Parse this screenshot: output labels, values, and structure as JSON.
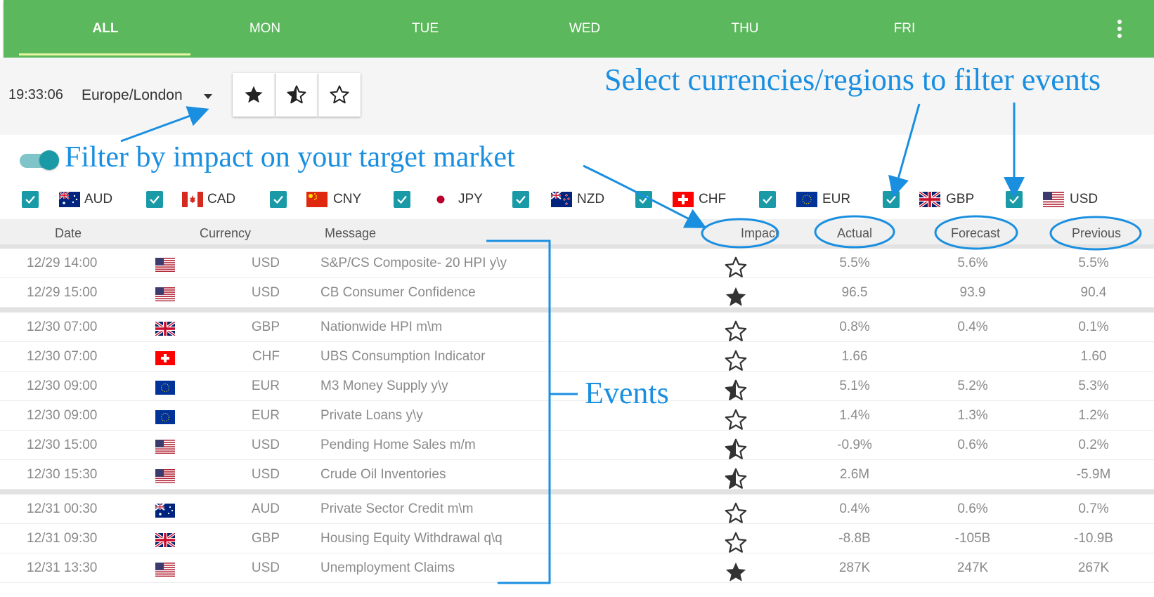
{
  "tabs": [
    {
      "label": "ALL",
      "active": true
    },
    {
      "label": "MON",
      "active": false
    },
    {
      "label": "TUE",
      "active": false
    },
    {
      "label": "WED",
      "active": false
    },
    {
      "label": "THU",
      "active": false
    },
    {
      "label": "FRI",
      "active": false
    }
  ],
  "toolbar": {
    "time": "19:33:06",
    "timezone": "Europe/London",
    "impact_filters": [
      "high-impact-star-icon",
      "medium-impact-star-icon",
      "low-impact-star-icon"
    ]
  },
  "filter": {
    "impact_toggle_on": true,
    "currencies": [
      {
        "code": "AUD",
        "checked": true
      },
      {
        "code": "CAD",
        "checked": true
      },
      {
        "code": "CNY",
        "checked": true
      },
      {
        "code": "JPY",
        "checked": true
      },
      {
        "code": "NZD",
        "checked": true
      },
      {
        "code": "CHF",
        "checked": true
      },
      {
        "code": "EUR",
        "checked": true
      },
      {
        "code": "GBP",
        "checked": true
      },
      {
        "code": "USD",
        "checked": true
      }
    ]
  },
  "table": {
    "headers": {
      "date": "Date",
      "currency": "Currency",
      "message": "Message",
      "impact": "Impact",
      "actual": "Actual",
      "forecast": "Forecast",
      "previous": "Previous"
    },
    "rows": [
      {
        "date": "12/29 14:00",
        "currency": "USD",
        "message": "S&P/CS Composite- 20 HPI y\\y",
        "impact": "low",
        "actual": "5.5%",
        "forecast": "5.6%",
        "previous": "5.5%",
        "day_start": true
      },
      {
        "date": "12/29 15:00",
        "currency": "USD",
        "message": "CB Consumer Confidence",
        "impact": "high",
        "actual": "96.5",
        "forecast": "93.9",
        "previous": "90.4",
        "day_start": false
      },
      {
        "date": "12/30 07:00",
        "currency": "GBP",
        "message": "Nationwide HPI m\\m",
        "impact": "low",
        "actual": "0.8%",
        "forecast": "0.4%",
        "previous": "0.1%",
        "day_start": true
      },
      {
        "date": "12/30 07:00",
        "currency": "CHF",
        "message": "UBS Consumption Indicator",
        "impact": "low",
        "actual": "1.66",
        "forecast": "",
        "previous": "1.60",
        "day_start": false
      },
      {
        "date": "12/30 09:00",
        "currency": "EUR",
        "message": "M3 Money Supply y\\y",
        "impact": "medium",
        "actual": "5.1%",
        "forecast": "5.2%",
        "previous": "5.3%",
        "day_start": false
      },
      {
        "date": "12/30 09:00",
        "currency": "EUR",
        "message": "Private Loans y\\y",
        "impact": "low",
        "actual": "1.4%",
        "forecast": "1.3%",
        "previous": "1.2%",
        "day_start": false
      },
      {
        "date": "12/30 15:00",
        "currency": "USD",
        "message": "Pending Home Sales m/m",
        "impact": "medium",
        "actual": "-0.9%",
        "forecast": "0.6%",
        "previous": "0.2%",
        "day_start": false
      },
      {
        "date": "12/30 15:30",
        "currency": "USD",
        "message": "Crude Oil Inventories",
        "impact": "medium",
        "actual": "2.6M",
        "forecast": "",
        "previous": "-5.9M",
        "day_start": false
      },
      {
        "date": "12/31 00:30",
        "currency": "AUD",
        "message": "Private Sector Credit m\\m",
        "impact": "low",
        "actual": "0.4%",
        "forecast": "0.6%",
        "previous": "0.7%",
        "day_start": true
      },
      {
        "date": "12/31 09:30",
        "currency": "GBP",
        "message": "Housing Equity Withdrawal q\\q",
        "impact": "low",
        "actual": "-8.8B",
        "forecast": "-105B",
        "previous": "-10.9B",
        "day_start": false
      },
      {
        "date": "12/31 13:30",
        "currency": "USD",
        "message": "Unemployment Claims",
        "impact": "high",
        "actual": "287K",
        "forecast": "247K",
        "previous": "267K",
        "day_start": false
      }
    ]
  },
  "annotations": {
    "select_currencies": "Select currencies/regions to filter events",
    "filter_impact": "Filter by impact on your target market",
    "events": "Events"
  },
  "colors": {
    "tabbar": "#5cb85c",
    "checkbox": "#1a9aa6",
    "annotation": "#1a8fe0"
  }
}
